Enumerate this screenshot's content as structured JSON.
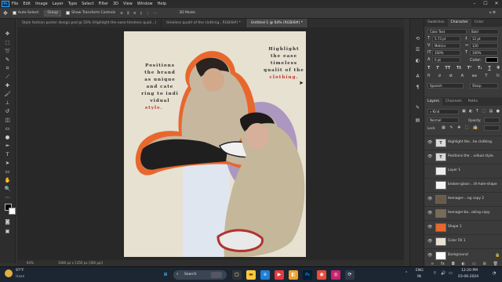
{
  "menubar": {
    "app_logo": "Ps",
    "items": [
      "File",
      "Edit",
      "Image",
      "Layer",
      "Type",
      "Select",
      "Filter",
      "3D",
      "View",
      "Window",
      "Help"
    ],
    "window_controls": [
      "–",
      "☐",
      "✕"
    ]
  },
  "options": {
    "home_icon": "home-icon",
    "auto_select_label": "Auto-Select:",
    "auto_select_value": "Group",
    "transform_label": "Show Transform Controls",
    "align_icons": "≡ ⫼ ≡ ⫾ ⋮ ⋯",
    "mode_3d": "3D Mode:",
    "icons_right": "⌂ ⚙"
  },
  "tabs": [
    {
      "label": "Style fashion poster design.psd @ 50% (Highlight  the ease  timeless quali...)",
      "active": false
    },
    {
      "label": "timeless qualit of the clothing., RGB/8#) *",
      "active": false
    },
    {
      "label": "Untitled-1 @ 64% (RGB/8#) *",
      "active": true
    }
  ],
  "poster": {
    "left_text": [
      "Positions",
      "the brand",
      "as unique",
      "and cate",
      "ring to indi",
      "vidual"
    ],
    "left_highlight": "style.",
    "right_text": [
      "Highlight",
      "the ease",
      "timeless",
      "qualit of the"
    ],
    "right_highlight": "clothing."
  },
  "status": {
    "zoom": "64%",
    "doc_info": "1080 px x 1350 px (300 ppi)"
  },
  "character": {
    "tabs": [
      "Swatches",
      "Character",
      "Color"
    ],
    "active_tab": "Character",
    "font_family": "Coke Text",
    "font_style": "Bold",
    "font_size": "5.73 pt",
    "leading": "12 pt",
    "kerning": "Metrics",
    "tracking": "120",
    "vscale": "100%",
    "hscale": "100%",
    "baseline": "0 pt",
    "color_label": "Color:",
    "language": "Spanish",
    "antialias": "Sharp",
    "style_buttons": [
      "T",
      "T",
      "TT",
      "Tt",
      "T¹",
      "T₁",
      "T",
      "T"
    ]
  },
  "layers": {
    "tabs": [
      "Layers",
      "Channels",
      "Paths"
    ],
    "active_tab": "Layers",
    "filter_kind": "Kind",
    "blend_mode": "Normal",
    "opacity_label": "Opacity:",
    "lock_label": "Lock:",
    "fill_label": "Fill:",
    "items": [
      {
        "name": "Highlight  the...he  clothing.",
        "type": "text",
        "visible": true
      },
      {
        "name": "Positions  the ...vidual  style.",
        "type": "text",
        "visible": true
      },
      {
        "name": "Layer 1",
        "type": "pixel",
        "visible": false
      },
      {
        "name": "broken-glass-...th-hole-shape",
        "type": "pixel",
        "visible": false
      },
      {
        "name": "teenager-...ng copy 2",
        "type": "pixel",
        "visible": true
      },
      {
        "name": "teenager-bo...oking copy",
        "type": "pixel",
        "visible": true
      },
      {
        "name": "Shape 1",
        "type": "shape",
        "visible": true
      },
      {
        "name": "Color Fill 1",
        "type": "fill",
        "visible": true
      },
      {
        "name": "Background",
        "type": "pixel",
        "visible": true
      }
    ]
  },
  "taskbar": {
    "weather_temp": "97°F",
    "weather_cond": "Haze",
    "search_placeholder": "Search",
    "lang": "ENG",
    "region": "IN",
    "time": "12:20 PM",
    "date": "03-06-2024"
  },
  "colors": {
    "accent": "#31a8ff",
    "poster_red": "#c3342a",
    "poster_bg": "#e6e1d1",
    "outline_orange": "#e8672d",
    "purple_glow": "#6b4fa0"
  }
}
